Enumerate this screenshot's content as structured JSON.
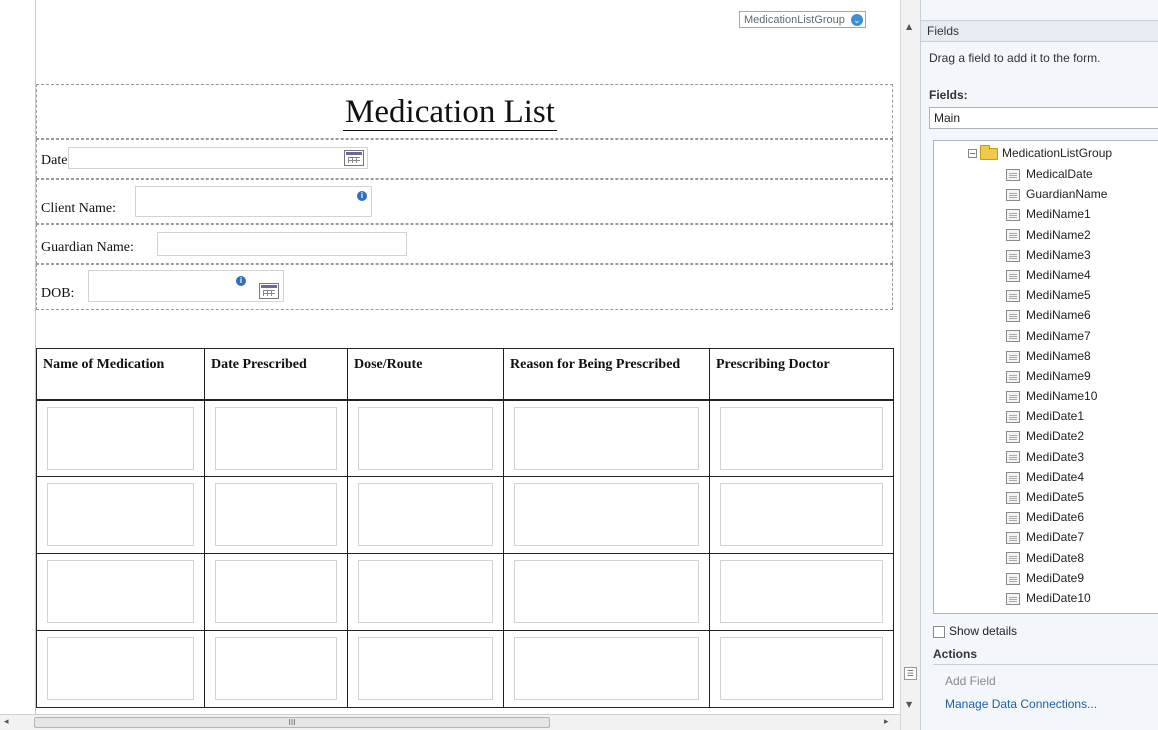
{
  "canvas": {
    "group_tag": "MedicationListGroup",
    "form_title": "Medication List",
    "labels": {
      "date": "Date:",
      "client_name": "Client Name:",
      "guardian_name": "Guardian Name:",
      "dob": "DOB:"
    },
    "table": {
      "headers": [
        "Name of Medication",
        "Date Prescribed",
        "Dose/Route",
        "Reason for Being Prescribed",
        "Prescribing Doctor"
      ],
      "visible_rows": 4
    },
    "hscroll_grip": "III"
  },
  "pane": {
    "title": "Fields",
    "hint": "Drag a field to add it to the form.",
    "fields_label": "Fields:",
    "datasource": "Main",
    "tree": {
      "root": "MedicationListGroup",
      "items": [
        "MedicalDate",
        "GuardianName",
        "MediName1",
        "MediName2",
        "MediName3",
        "MediName4",
        "MediName5",
        "MediName6",
        "MediName7",
        "MediName8",
        "MediName9",
        "MediName10",
        "MediDate1",
        "MediDate2",
        "MediDate3",
        "MediDate4",
        "MediDate5",
        "MediDate6",
        "MediDate7",
        "MediDate8",
        "MediDate9",
        "MediDate10"
      ]
    },
    "show_details": "Show details",
    "actions_label": "Actions",
    "add_field": "Add Field",
    "manage_connections": "Manage Data Connections..."
  },
  "colors": {
    "pane_bg": "#f3f6fa",
    "link": "#1f5fa8",
    "tag_border": "#6fb7e8",
    "info_icon": "#2e6fc1"
  }
}
